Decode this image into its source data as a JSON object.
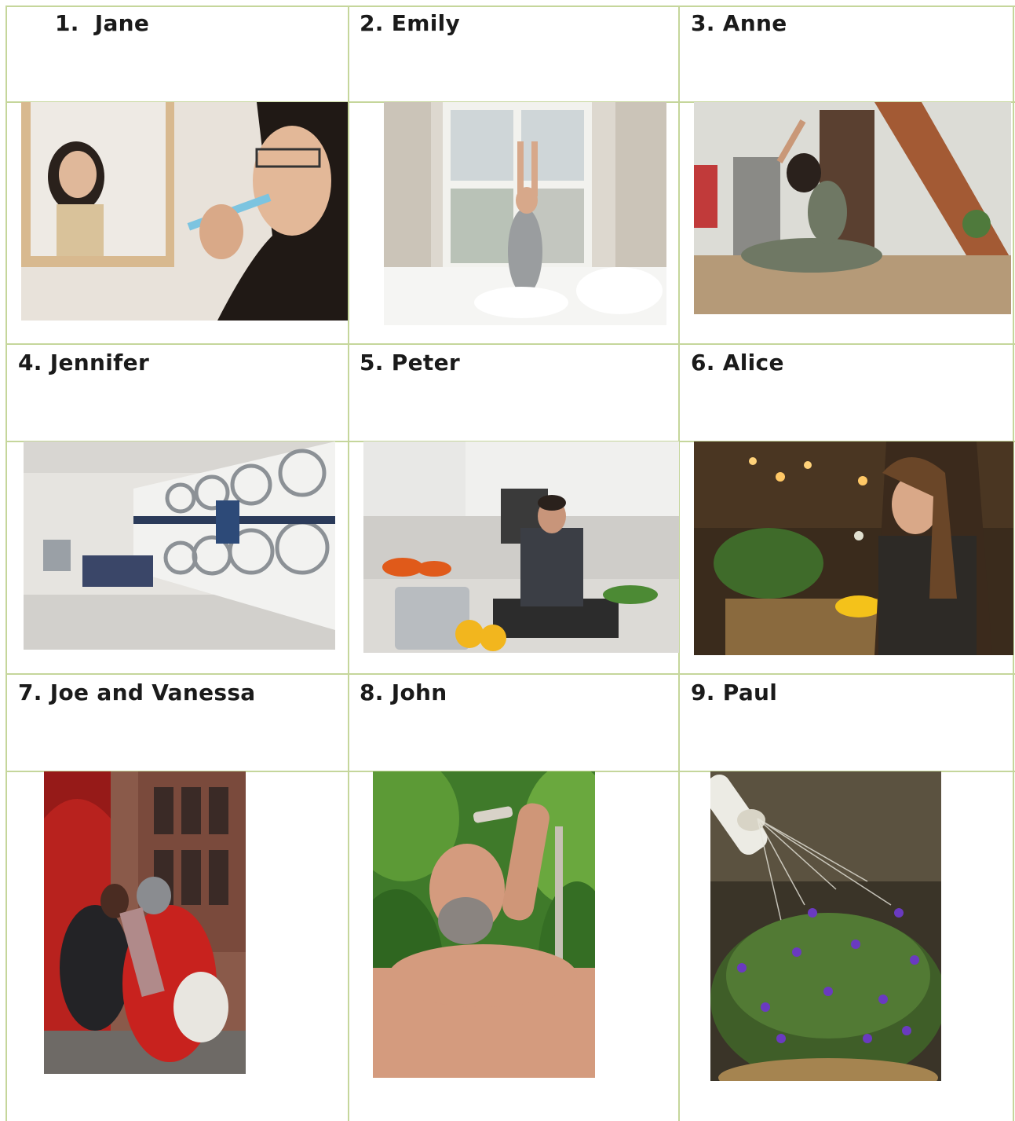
{
  "rows": [
    {
      "cells": [
        {
          "number": "1.",
          "name": "Jane",
          "photo": "woman-brushing-teeth-photo"
        },
        {
          "number": "2.",
          "name": "Emily",
          "photo": "woman-stretching-in-bed-photo"
        },
        {
          "number": "3.",
          "name": "Anne",
          "photo": "woman-doing-yoga-photo"
        }
      ]
    },
    {
      "cells": [
        {
          "number": "4.",
          "name": "Jennifer",
          "photo": "laundromat-washing-machines-photo"
        },
        {
          "number": "5.",
          "name": "Peter",
          "photo": "man-cooking-in-kitchen-photo"
        },
        {
          "number": "6.",
          "name": "Alice",
          "photo": "woman-eating-at-restaurant-photo"
        }
      ]
    },
    {
      "cells": [
        {
          "number": "7.",
          "name": "Joe and Vanessa",
          "photo": "couple-walking-on-street-photo"
        },
        {
          "number": "8.",
          "name": "John",
          "photo": "man-taking-outdoor-shower-photo"
        },
        {
          "number": "9.",
          "name": "Paul",
          "photo": "watering-flowers-photo"
        }
      ]
    }
  ],
  "colors": {
    "border": "#c5d69b",
    "text": "#1a1a1a"
  }
}
